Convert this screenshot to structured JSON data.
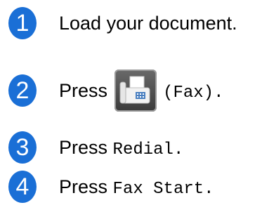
{
  "steps": [
    {
      "number": "1",
      "text": "Load your document."
    },
    {
      "number": "2",
      "prefix": "Press",
      "key_label": "(Fax).",
      "icon": "fax-icon"
    },
    {
      "number": "3",
      "prefix": "Press",
      "key_label": "Redial."
    },
    {
      "number": "4",
      "prefix": "Press",
      "key_label": "Fax Start."
    }
  ],
  "colors": {
    "badge": "#1a6fd6"
  }
}
